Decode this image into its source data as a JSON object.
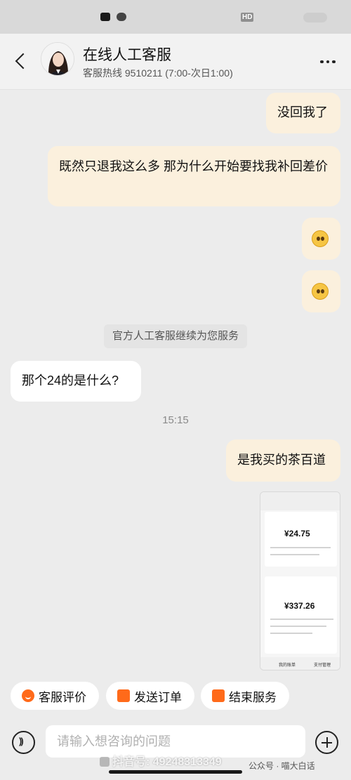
{
  "status_bar": {
    "badge": "HD"
  },
  "header": {
    "title": "在线人工客服",
    "subtitle": "客服热线 9510211 (7:00-次日1:00)"
  },
  "messages": [
    {
      "from": "me",
      "text": "没回我了"
    },
    {
      "from": "me",
      "text": "既然只退我这么多 那为什么开始要找我补回差价"
    },
    {
      "from": "me",
      "emoji": "pleading-face"
    },
    {
      "from": "me",
      "emoji": "pleading-face"
    },
    {
      "from": "system",
      "text": "官方人工客服继续为您服务"
    },
    {
      "from": "agent",
      "text": "那个24的是什么?"
    },
    {
      "from": "divider",
      "text": "15:15"
    },
    {
      "from": "me",
      "text": "是我买的茶百道"
    }
  ],
  "image_message": {
    "amount_1": "¥24.75",
    "amount_2": "¥337.26",
    "tab_1": "我的账单",
    "tab_2": "支付管理"
  },
  "actions": [
    {
      "label": "客服评价",
      "icon": "smile-icon"
    },
    {
      "label": "发送订单",
      "icon": "bag-icon"
    },
    {
      "label": "结束服务",
      "icon": "exit-icon"
    }
  ],
  "input": {
    "placeholder": "请输入想咨询的问题"
  },
  "watermark": "抖音号: 49248313349",
  "wechat_mark": "公众号 · 喵大白话",
  "colors": {
    "accent": "#ff6a1a",
    "my_bubble": "#fbf0dd",
    "agent_bubble": "#ffffff",
    "background": "#ececec"
  }
}
